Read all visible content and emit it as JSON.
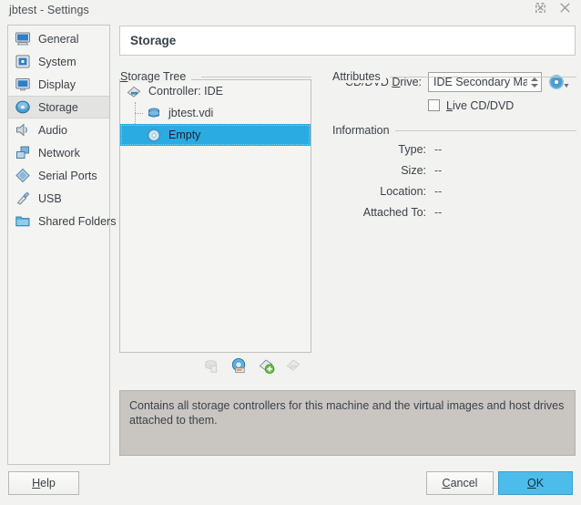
{
  "window": {
    "title": "jbtest - Settings",
    "controls": [
      {
        "name": "maximize",
        "glyph": "maximize-icon"
      },
      {
        "name": "close",
        "glyph": "close-icon"
      }
    ]
  },
  "sidebar": {
    "items": [
      {
        "label": "General",
        "icon": "monitor-icon",
        "selected": false
      },
      {
        "label": "System",
        "icon": "chip-icon",
        "selected": false
      },
      {
        "label": "Display",
        "icon": "display-icon",
        "selected": false
      },
      {
        "label": "Storage",
        "icon": "storage-disk-icon",
        "selected": true
      },
      {
        "label": "Audio",
        "icon": "speaker-icon",
        "selected": false
      },
      {
        "label": "Network",
        "icon": "network-icon",
        "selected": false
      },
      {
        "label": "Serial Ports",
        "icon": "serial-port-icon",
        "selected": false
      },
      {
        "label": "USB",
        "icon": "usb-icon",
        "selected": false
      },
      {
        "label": "Shared Folders",
        "icon": "folder-icon",
        "selected": false
      }
    ]
  },
  "page": {
    "title": "Storage"
  },
  "storage_tree": {
    "group_label": "Storage Tree",
    "group_label_mnemonic": "S",
    "nodes": [
      {
        "label": "Controller: IDE",
        "icon": "controller-icon",
        "level": 0,
        "selected": false
      },
      {
        "label": "jbtest.vdi",
        "icon": "hard-disk-icon",
        "level": 1,
        "selected": false
      },
      {
        "label": "Empty",
        "icon": "cd-dvd-icon",
        "level": 1,
        "selected": true
      }
    ],
    "toolbar": [
      {
        "name": "add-hard-disk-button",
        "icon": "add-hard-disk-icon",
        "disabled": true
      },
      {
        "name": "add-cd-dvd-device-button",
        "icon": "add-cd-dvd-icon",
        "disabled": false
      },
      {
        "name": "add-controller-button",
        "icon": "add-controller-icon",
        "disabled": false
      },
      {
        "name": "remove-controller-button",
        "icon": "remove-controller-icon",
        "disabled": true
      }
    ]
  },
  "attributes": {
    "group_label": "Attributes",
    "cd_drive_label": "CD/DVD Drive:",
    "cd_drive_label_mnemonic": "D",
    "cd_drive_value": "IDE Secondary Maste",
    "cd_picker_icon": "cd-dvd-picker-icon",
    "live_cd_label": "Live CD/DVD",
    "live_cd_label_mnemonic": "L",
    "live_cd_checked": false
  },
  "information": {
    "group_label": "Information",
    "rows": [
      {
        "label": "Type:",
        "value": "--"
      },
      {
        "label": "Size:",
        "value": "--"
      },
      {
        "label": "Location:",
        "value": "--"
      },
      {
        "label": "Attached To:",
        "value": "--"
      }
    ]
  },
  "description": {
    "text": "Contains all storage controllers for this machine and the virtual images and host drives attached to them."
  },
  "buttons": {
    "help": "Help",
    "help_mnemonic": "H",
    "cancel": "Cancel",
    "cancel_mnemonic": "C",
    "ok": "OK",
    "ok_mnemonic": "O"
  },
  "colors": {
    "selection_blue": "#2aabe2",
    "primary_button": "#4ebcea",
    "window_bg": "#f2f2f0",
    "description_bg": "#c9c6c2"
  }
}
